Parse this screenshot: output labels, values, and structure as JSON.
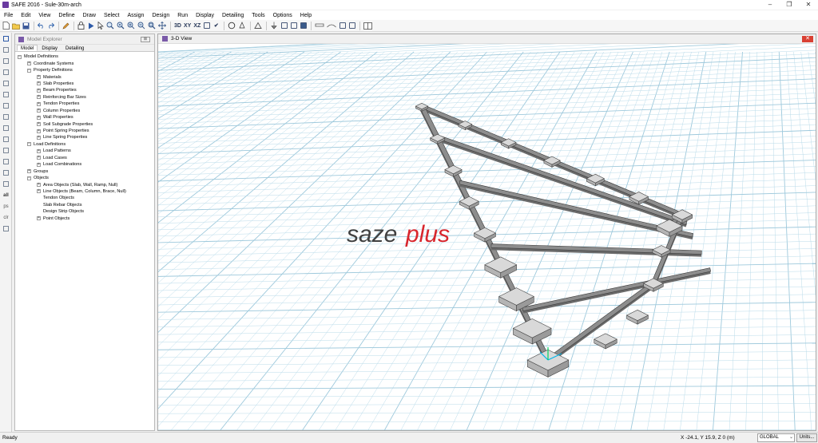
{
  "window": {
    "title": "SAFE 2016 - Sule-30m-arch",
    "minimize": "–",
    "maximize": "❐",
    "close": "✕"
  },
  "menu": [
    "File",
    "Edit",
    "View",
    "Define",
    "Draw",
    "Select",
    "Assign",
    "Design",
    "Run",
    "Display",
    "Detailing",
    "Tools",
    "Options",
    "Help"
  ],
  "toolbar": {
    "labels": {
      "view3d": "3D",
      "xy": "XY",
      "xz": "XZ"
    },
    "icons": [
      "new-file-icon",
      "open-folder-icon",
      "save-icon",
      "undo-icon",
      "redo-icon",
      "pencil-icon",
      "lock-icon",
      "run-icon",
      "pointer-icon",
      "zoom-window-icon",
      "zoom-previous-icon",
      "zoom-in-icon",
      "zoom-out-icon",
      "zoom-all-icon",
      "pan-icon",
      "3d-view-icon",
      "plan-view-icon",
      "elevation-view-icon"
    ]
  },
  "explorer": {
    "title": "Model Explorer",
    "close": "⊠",
    "tabs": [
      "Model",
      "Display",
      "Detailing"
    ],
    "active_tab": 0,
    "tree": [
      {
        "label": "Model Definitions",
        "level": 0,
        "exp": "−"
      },
      {
        "label": "Coordinate Systems",
        "level": 1,
        "exp": "+"
      },
      {
        "label": "Property Definitions",
        "level": 1,
        "exp": "−"
      },
      {
        "label": "Materials",
        "level": 2,
        "exp": "+"
      },
      {
        "label": "Slab Properties",
        "level": 2,
        "exp": "+"
      },
      {
        "label": "Beam Properties",
        "level": 2,
        "exp": "+"
      },
      {
        "label": "Reinforcing Bar Sizes",
        "level": 2,
        "exp": "+"
      },
      {
        "label": "Tendon Properties",
        "level": 2,
        "exp": "+"
      },
      {
        "label": "Column Properties",
        "level": 2,
        "exp": "+"
      },
      {
        "label": "Wall Properties",
        "level": 2,
        "exp": "+"
      },
      {
        "label": "Soil Subgrade Properties",
        "level": 2,
        "exp": "+"
      },
      {
        "label": "Point Spring Properties",
        "level": 2,
        "exp": "+"
      },
      {
        "label": "Line Spring Properties",
        "level": 2,
        "exp": "+"
      },
      {
        "label": "Load Definitions",
        "level": 1,
        "exp": "−"
      },
      {
        "label": "Load Patterns",
        "level": 2,
        "exp": "+"
      },
      {
        "label": "Load Cases",
        "level": 2,
        "exp": "+"
      },
      {
        "label": "Load Combinations",
        "level": 2,
        "exp": "+"
      },
      {
        "label": "Groups",
        "level": 1,
        "exp": "+"
      },
      {
        "label": "Objects",
        "level": 1,
        "exp": "−"
      },
      {
        "label": "Area Objects (Slab, Wall, Ramp, Null)",
        "level": 2,
        "exp": "+"
      },
      {
        "label": "Line Objects (Beam, Column, Brace, Null)",
        "level": 2,
        "exp": "+"
      },
      {
        "label": "Tendon Objects",
        "level": 2,
        "exp": ""
      },
      {
        "label": "Slab Rebar Objects",
        "level": 2,
        "exp": ""
      },
      {
        "label": "Design Strip Objects",
        "level": 2,
        "exp": ""
      },
      {
        "label": "Point Objects",
        "level": 2,
        "exp": "+"
      }
    ]
  },
  "view": {
    "title": "3-D View",
    "close": "✕",
    "watermark": {
      "left": "saze",
      "right": "plus"
    }
  },
  "lefttools": [
    "pointer-icon",
    "reshape-icon",
    "draw-area-icon",
    "draw-rect-icon",
    "draw-slab-icon",
    "draw-wall-icon",
    "draw-line-icon",
    "draw-beam-icon",
    "draw-column-icon",
    "draw-brace-icon",
    "draw-point-icon",
    "draw-strip-icon",
    "draw-tendon-icon",
    "snap-icon",
    "select-all-icon",
    "previous-selection-icon",
    "clear-selection-icon",
    "intersecting-line-icon"
  ],
  "lefttool_labels": {
    "all": "all",
    "ps": "ps",
    "clr": "clr"
  },
  "status": {
    "ready": "Ready",
    "coords": "X -24.1,  Y 15.9,  Z 0   (m)",
    "coord_system": "GLOBAL",
    "units_button": "Units..."
  },
  "colors": {
    "accent": "#7a5aa8",
    "grid": "#b9dbea",
    "gridMajor": "#9ec9dc",
    "beam": "#8d8d8d",
    "footing": "#d9d9d9",
    "watermark_red": "#d8262d",
    "watermark_dark": "#404040"
  }
}
